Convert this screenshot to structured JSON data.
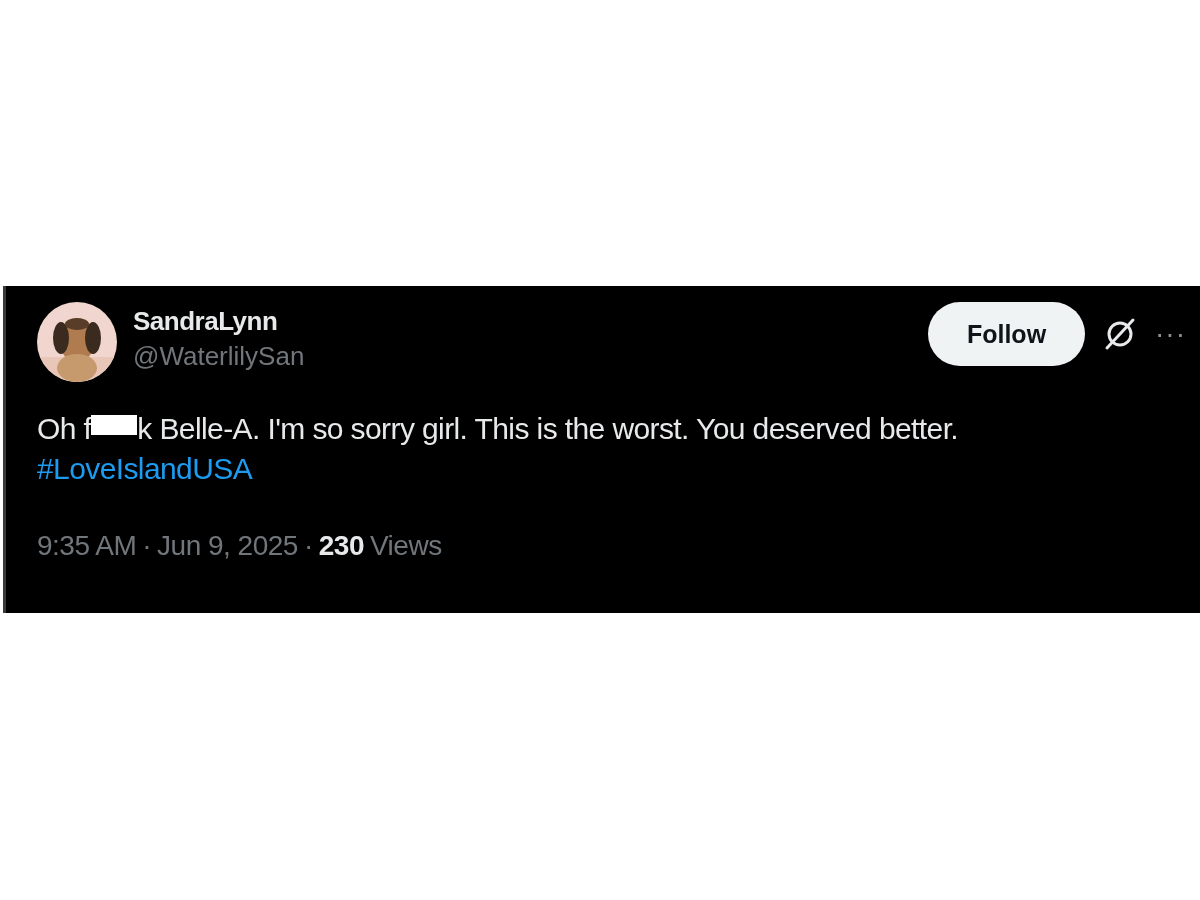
{
  "post": {
    "author": {
      "name": "SandraLynn",
      "handle": "@WaterlilySan"
    },
    "follow_button": "Follow",
    "more_button": "···",
    "text": {
      "before_redaction": "Oh f",
      "redacted": true,
      "after_redaction": "k Belle-A. I'm so sorry girl. This is the worst. You deserved better.",
      "hashtag": "#LoveIslandUSA"
    },
    "meta": {
      "time": "9:35 AM",
      "separator_1": "·",
      "date": "Jun 9, 2025",
      "separator_2": "·",
      "views_count": "230",
      "views_label": "Views"
    }
  }
}
